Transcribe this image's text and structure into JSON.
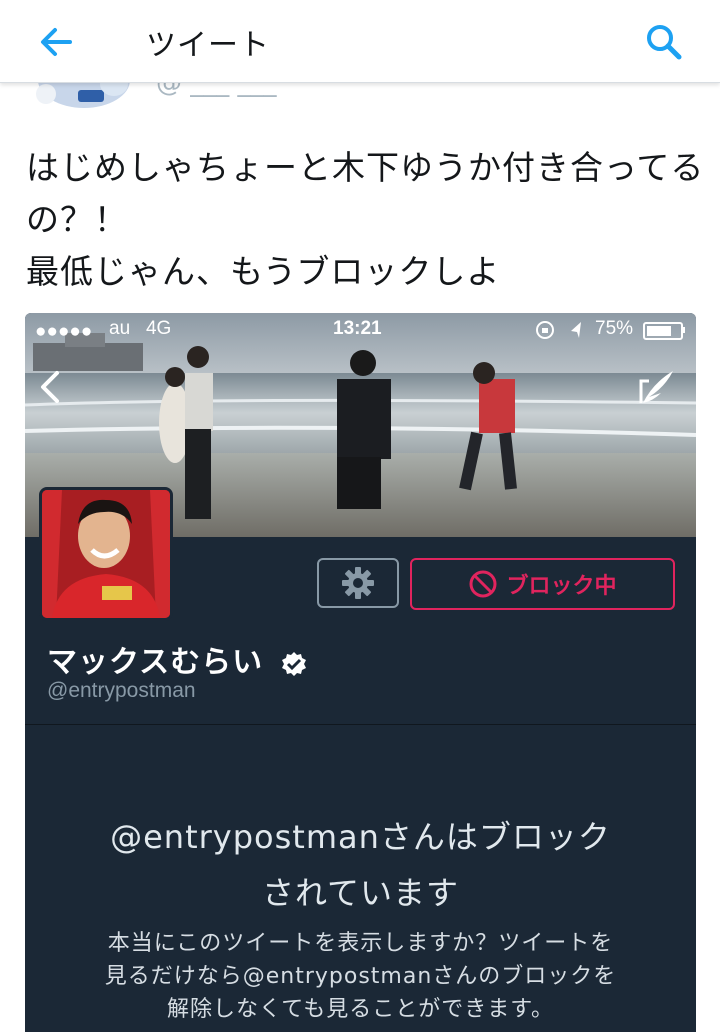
{
  "topbar": {
    "title": "ツイート",
    "back_icon": "arrow-left-icon",
    "search_icon": "search-icon",
    "accent_color": "#1da1f2"
  },
  "tweet": {
    "text": "はじめしゃちょーと木下ゆうか付き合ってるの？！\n最低じゃん、もうブロックしよ"
  },
  "screenshot": {
    "statusbar": {
      "signal": "●●●●●",
      "carrier": "au",
      "network": "4G",
      "time": "13:21",
      "battery": "75%",
      "battery_level": 0.75
    },
    "profile": {
      "display_name": "マックスむらい",
      "screen_name": "@entrypostman",
      "blocked_button": "ブロック中",
      "blocked_color": "#e0245e"
    },
    "blocked_notice": {
      "title": "@entrypostmanさんはブロック\nされています",
      "description": "本当にこのツイートを表示しますか？ツイートを\n見るだけなら@entrypostmanさんのブロックを\n解除しなくても見ることができます。"
    }
  }
}
